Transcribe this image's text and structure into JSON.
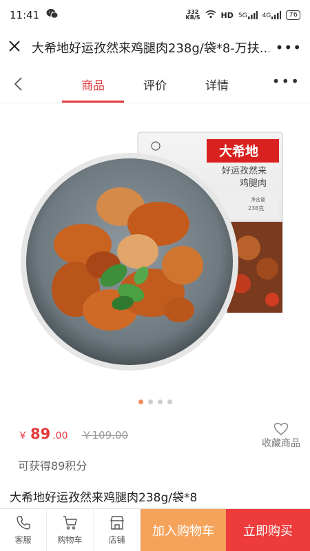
{
  "status": {
    "time": "11:41",
    "net_speed_value": "332",
    "net_speed_unit": "KB/S",
    "hd_label": "HD",
    "signal_5g": "5G",
    "signal_4g": "4G",
    "battery": "76"
  },
  "titlebar": {
    "title": "大希地好运孜然来鸡腿肉238g/袋*8-万扶..."
  },
  "nav": {
    "tabs": [
      {
        "label": "商品",
        "active": true
      },
      {
        "label": "评价",
        "active": false
      },
      {
        "label": "详情",
        "active": false
      }
    ]
  },
  "gallery": {
    "package": {
      "brand": "大希地",
      "line1": "好运孜然来",
      "line2": "鸡腿肉",
      "net_weight_label": "净含量",
      "net_weight": "238克"
    },
    "page_count": 4,
    "active_index": 0
  },
  "price": {
    "currency": "￥",
    "integer": "89",
    "decimal": ".00",
    "original": "￥109.00"
  },
  "favorite": {
    "label": "收藏商品"
  },
  "points_text": "可获得89积分",
  "product_name": "大希地好运孜然来鸡腿肉238g/袋*8",
  "bottom_bar": {
    "service": "客服",
    "cart": "购物车",
    "store": "店铺",
    "add_to_cart": "加入购物车",
    "buy_now": "立即购买"
  },
  "colors": {
    "accent": "#e4393c",
    "cart_button": "#f5a35b",
    "buy_button": "#ee3b3b"
  }
}
